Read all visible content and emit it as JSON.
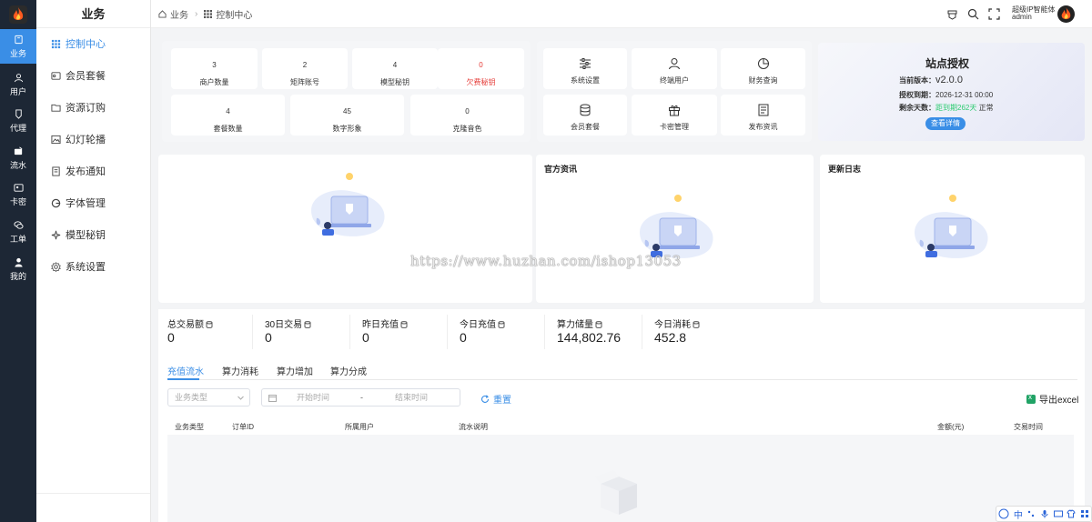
{
  "rail": {
    "items": [
      {
        "label": "业务",
        "icon": "briefcase-icon"
      },
      {
        "label": "用户",
        "icon": "user-icon"
      },
      {
        "label": "代理",
        "icon": "badge-icon"
      },
      {
        "label": "流水",
        "icon": "wallet-icon"
      },
      {
        "label": "卡密",
        "icon": "card-icon"
      },
      {
        "label": "工单",
        "icon": "chat-icon"
      },
      {
        "label": "我的",
        "icon": "person-icon"
      }
    ]
  },
  "sidebar": {
    "title": "业务",
    "items": [
      {
        "label": "控制中心",
        "icon": "grid-icon"
      },
      {
        "label": "会员套餐",
        "icon": "package-icon"
      },
      {
        "label": "资源订购",
        "icon": "folder-icon"
      },
      {
        "label": "幻灯轮播",
        "icon": "image-icon"
      },
      {
        "label": "发布通知",
        "icon": "notice-icon"
      },
      {
        "label": "字体管理",
        "icon": "font-icon"
      },
      {
        "label": "模型秘钥",
        "icon": "sparkle-icon"
      },
      {
        "label": "系统设置",
        "icon": "gear-icon"
      }
    ]
  },
  "header": {
    "breadcrumb": [
      "业务",
      "控制中心"
    ],
    "user_line1": "超级IP智能体",
    "user_line2": "admin"
  },
  "stats_top": [
    {
      "num": "3",
      "label": "商户数量"
    },
    {
      "num": "2",
      "label": "矩阵账号"
    },
    {
      "num": "4",
      "label": "模型秘钥"
    },
    {
      "num": "0",
      "label": "欠费秘钥"
    }
  ],
  "stats_bottom": [
    {
      "num": "4",
      "label": "套餐数量"
    },
    {
      "num": "45",
      "label": "数字形象"
    },
    {
      "num": "0",
      "label": "克隆音色"
    }
  ],
  "quick": [
    {
      "label": "系统设置",
      "icon": "sliders-icon"
    },
    {
      "label": "终端用户",
      "icon": "user-icon"
    },
    {
      "label": "财务查询",
      "icon": "pie-icon"
    },
    {
      "label": "会员套餐",
      "icon": "database-icon"
    },
    {
      "label": "卡密管理",
      "icon": "gift-icon"
    },
    {
      "label": "发布资讯",
      "icon": "document-icon"
    }
  ],
  "license": {
    "title": "站点授权",
    "version_label": "当前版本：",
    "version": "v2.0.0",
    "expiry_label": "授权到期：",
    "expiry": "2026-12-31 00:00",
    "remain_label": "剩余天数：",
    "remain": "距到期262天",
    "status": "正常",
    "button": "查看详情"
  },
  "cards": {
    "news_title": "官方资讯",
    "changelog_title": "更新日志"
  },
  "watermark": "https://www.huzhan.com/ishop13053",
  "kpis": [
    {
      "label": "总交易额",
      "value": "0"
    },
    {
      "label": "30日交易",
      "value": "0"
    },
    {
      "label": "昨日充值",
      "value": "0"
    },
    {
      "label": "今日充值",
      "value": "0"
    },
    {
      "label": "算力储量",
      "value": "144,802.76"
    },
    {
      "label": "今日消耗",
      "value": "452.8"
    }
  ],
  "tabs": [
    "充值流水",
    "算力消耗",
    "算力增加",
    "算力分成"
  ],
  "filters": {
    "type_placeholder": "业务类型",
    "start_placeholder": "开始时间",
    "dash": "-",
    "end_placeholder": "结束时间",
    "reset": "重置",
    "export": "导出excel"
  },
  "table": {
    "columns": [
      "业务类型",
      "订单ID",
      "所属用户",
      "流水说明",
      "金额(元)",
      "交易时间"
    ]
  },
  "ime": {
    "lang": "中"
  },
  "colors": {
    "accent": "#3a8ee6",
    "rail": "#1d2735",
    "danger": "#e53935",
    "success": "#2ecc71"
  }
}
